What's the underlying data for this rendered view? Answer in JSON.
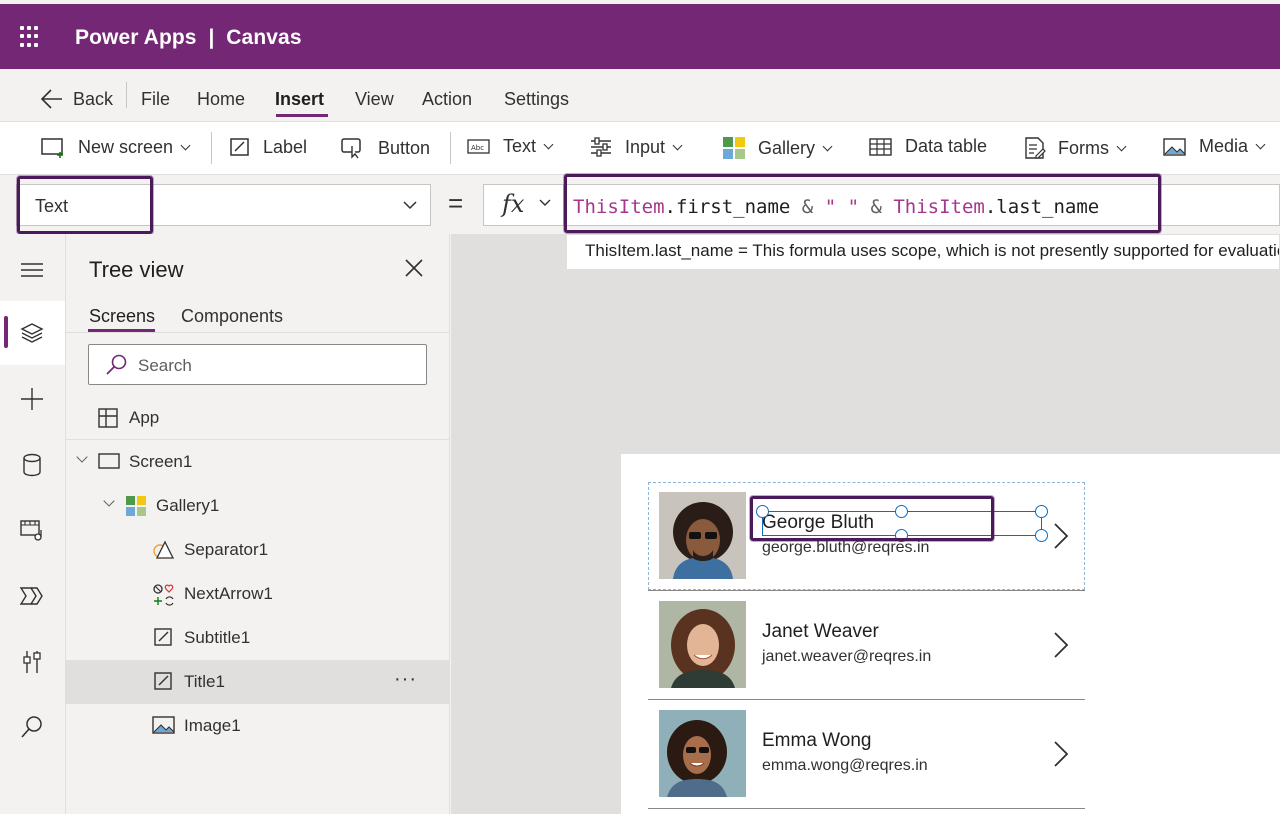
{
  "titlebar": {
    "app_title": "Power Apps  |  Canvas",
    "bg_color": "#742774"
  },
  "menu": {
    "back": "Back",
    "file": "File",
    "home": "Home",
    "insert": "Insert",
    "view": "View",
    "action": "Action",
    "settings": "Settings",
    "active": "Insert"
  },
  "ribbon": {
    "new_screen": "New screen",
    "label": "Label",
    "button": "Button",
    "text": "Text",
    "input": "Input",
    "gallery": "Gallery",
    "data_table": "Data table",
    "forms": "Forms",
    "media": "Media"
  },
  "formula_bar": {
    "property": "Text",
    "equals": "=",
    "fx": "fx",
    "formula": {
      "t1": "ThisItem",
      "t2": ".first_name ",
      "t3": "&",
      "t4": " \" \" ",
      "t5": "&",
      "t6": " ThisItem",
      "t7": ".last_name"
    },
    "tooltip": "ThisItem.last_name  =  This formula uses scope, which is not presently supported for evaluation."
  },
  "tree_view": {
    "title": "Tree view",
    "tabs": [
      "Screens",
      "Components"
    ],
    "active_tab": "Screens",
    "search_placeholder": "Search",
    "nodes": {
      "app": "App",
      "screen1": "Screen1",
      "gallery1": "Gallery1",
      "separator1": "Separator1",
      "nextarrow1": "NextArrow1",
      "subtitle1": "Subtitle1",
      "title1": "Title1",
      "image1": "Image1"
    },
    "selected": "Title1",
    "more": "···"
  },
  "gallery": {
    "items": [
      {
        "name": "George Bluth",
        "email": "george.bluth@reqres.in"
      },
      {
        "name": "Janet Weaver",
        "email": "janet.weaver@reqres.in"
      },
      {
        "name": "Emma Wong",
        "email": "emma.wong@reqres.in"
      }
    ],
    "selected_index": 0
  },
  "colors": {
    "accent": "#742774",
    "highlight_border": "#4b1a5a",
    "selection_blue": "#0f6cbd",
    "keyword": "#a4378c"
  }
}
